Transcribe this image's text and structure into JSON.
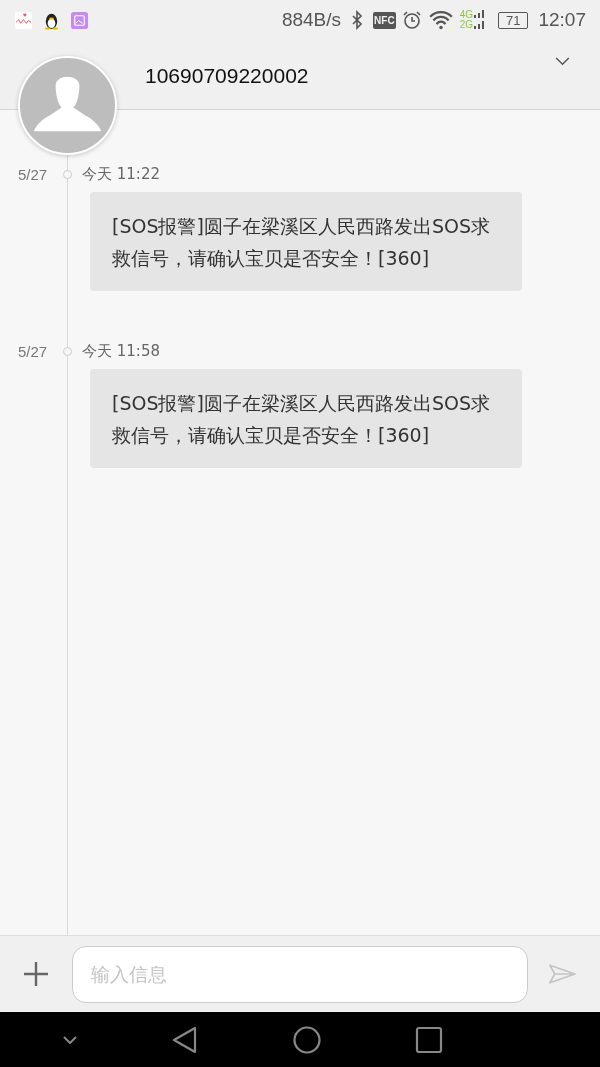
{
  "status_bar": {
    "speed": "884B/s",
    "nfc": "NFC",
    "network_top": "4G",
    "network_bottom": "2G",
    "battery": "71",
    "time": "12:07"
  },
  "header": {
    "title": "10690709220002"
  },
  "messages": [
    {
      "date": "5/27",
      "time": "今天 11:22",
      "text": "[SOS报警]圆子在梁溪区人民西路发出SOS求救信号，请确认宝贝是否安全！[360]"
    },
    {
      "date": "5/27",
      "time": "今天 11:58",
      "text": "[SOS报警]圆子在梁溪区人民西路发出SOS求救信号，请确认宝贝是否安全！[360]"
    }
  ],
  "composer": {
    "placeholder": "输入信息"
  }
}
